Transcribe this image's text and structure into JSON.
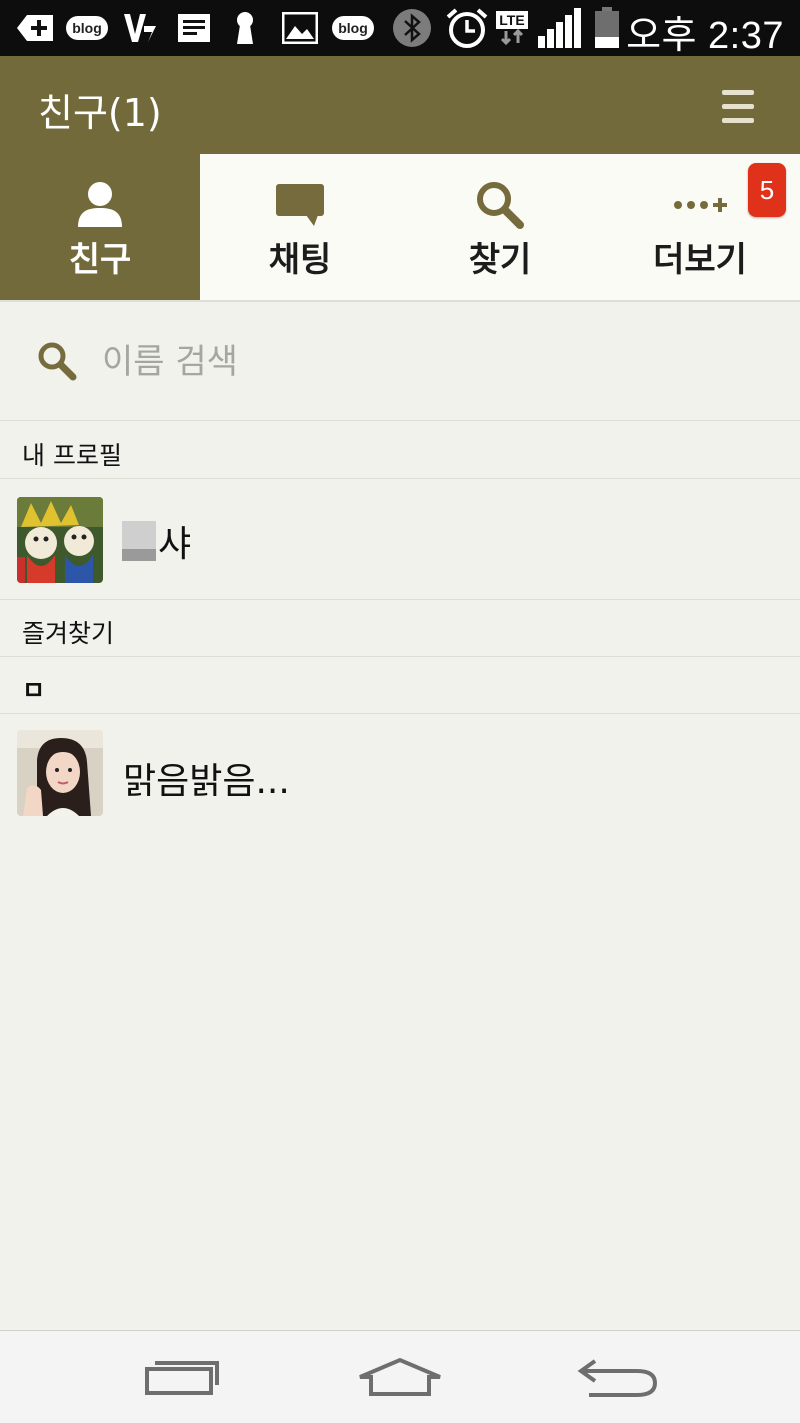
{
  "status_bar": {
    "icons": [
      "add-notification-icon",
      "blog-notification-icon",
      "v3-app-icon",
      "note-icon",
      "keyhole-icon",
      "image-icon",
      "blog-notification-icon",
      "bluetooth-icon",
      "alarm-icon",
      "lte-icon",
      "signal-icon",
      "battery-icon"
    ],
    "blog_label": "blog",
    "lte_label": "LTE",
    "time": "오후 2:37"
  },
  "header": {
    "title": "친구(1)"
  },
  "tabs": [
    {
      "label": "친구",
      "icon": "person-icon",
      "active": true
    },
    {
      "label": "채팅",
      "icon": "chat-bubble-icon",
      "active": false
    },
    {
      "label": "찾기",
      "icon": "search-icon",
      "active": false
    },
    {
      "label": "더보기",
      "icon": "more-icon",
      "active": false,
      "badge": "5"
    }
  ],
  "search": {
    "placeholder": "이름 검색"
  },
  "sections": {
    "my_profile": "내 프로필",
    "favorites": "즐겨찾기",
    "index_letter": "ㅁ"
  },
  "my_profile": {
    "name_suffix": "샤"
  },
  "friends": [
    {
      "name": "맑음밝음..."
    }
  ],
  "colors": {
    "header_bg": "#736a3c",
    "list_bg": "#f2f2ec",
    "badge": "#e0311b",
    "icon_olive": "#756b3d"
  },
  "nav_bar": {
    "buttons": [
      "recent-apps-icon",
      "home-icon",
      "back-icon"
    ]
  }
}
